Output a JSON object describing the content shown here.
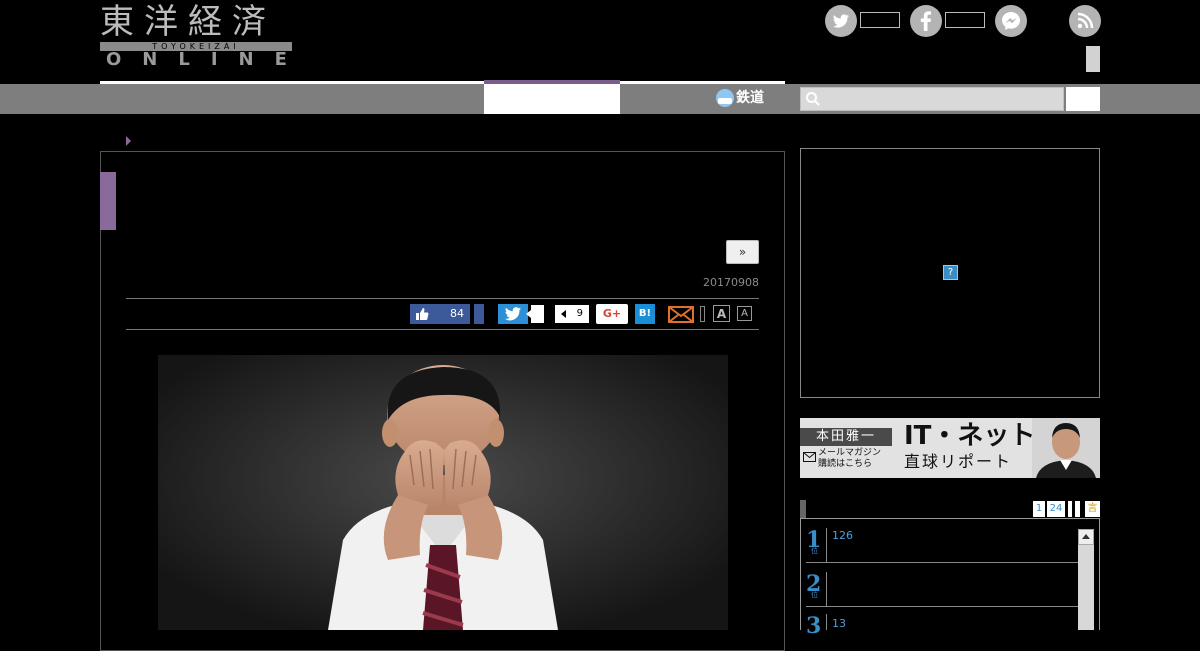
{
  "header": {
    "logo_kanji": "東洋経済",
    "logo_band": "TOYOKEIZAI",
    "logo_online": "ONLINE"
  },
  "social": {
    "twitter_icon": "twitter-icon",
    "facebook_icon": "facebook-icon",
    "messenger_icon": "messenger-icon",
    "rss_icon": "rss-icon"
  },
  "nav": {
    "railway_label": "鉄道",
    "search_placeholder": ""
  },
  "article": {
    "next_label": "»",
    "date": "20170908",
    "share": {
      "like_count": "84",
      "hatena_count": "9",
      "gplus_label": "G+",
      "hatena_label": "B!",
      "font_large": "A",
      "font_small": "A"
    }
  },
  "sidebar": {
    "ad_help": "?",
    "banner": {
      "author": "本田雅一",
      "mail_text_1": "メールマガジン",
      "mail_text_2": "購読はこちら",
      "title": "IT・ネット",
      "subtitle": "直球リポート"
    },
    "ranking": {
      "tabs": [
        "1",
        "24",
        "",
        "",
        "言"
      ],
      "items": [
        {
          "rank": "1",
          "unit": "位",
          "text": "126"
        },
        {
          "rank": "2",
          "unit": "位",
          "text": ""
        },
        {
          "rank": "3",
          "unit": "位",
          "text": "13"
        }
      ]
    }
  },
  "colors": {
    "accent_purple": "#8a6a9a",
    "nav_gray": "#7e7e7e",
    "link_blue": "#3a8ec6",
    "facebook_blue": "#3c5a9a",
    "twitter_blue": "#2d8fd5"
  }
}
